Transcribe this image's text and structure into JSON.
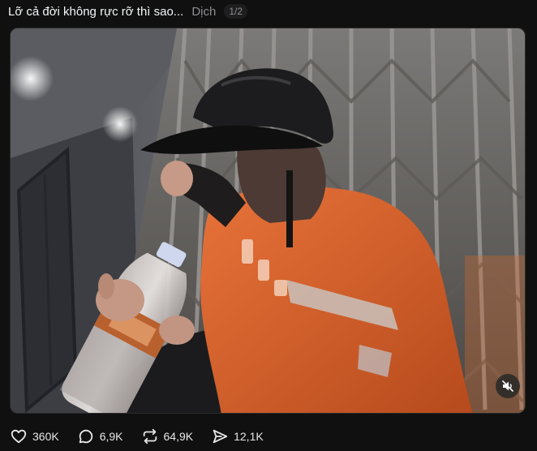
{
  "post": {
    "caption": "Lỡ cả đời không rực rỡ thì sao...",
    "translate_label": "Dịch",
    "media_index": "1/2"
  },
  "media": {
    "mute_icon": "speaker-muted-icon"
  },
  "actions": {
    "likes": "360K",
    "replies": "6,9K",
    "reposts": "64,9K",
    "shares": "12,1K"
  },
  "colors": {
    "background": "#101010",
    "text": "#f3f5f7",
    "muted": "#8e8e93",
    "jacket_orange": "#e0642a"
  }
}
